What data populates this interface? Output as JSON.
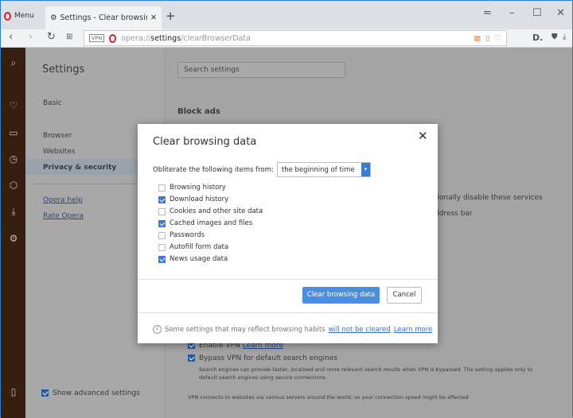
{
  "tabbar": {
    "menu_label": "Menu",
    "tab_title": "Settings - Clear browsing data",
    "new_tab": "+"
  },
  "toolbar": {
    "url_host": "opera://",
    "url_path": "settings",
    "url_rest": "/clearBrowserData",
    "vpn_badge": "VPN"
  },
  "nav": {
    "title": "Settings",
    "items": [
      "Basic",
      "Browser",
      "Websites",
      "Privacy & security"
    ],
    "links": [
      "Opera help",
      "Rate Opera"
    ],
    "show_advanced": "Show advanced settings",
    "show_advanced_checked": true
  },
  "main": {
    "search_placeholder": "Search settings",
    "block_ads": "Block ads",
    "partial1": "tionally disable these services",
    "partial2": "ddress bar",
    "enable_vpn": "Enable VPN",
    "learn_more": "Learn more",
    "bypass_vpn": "Bypass VPN for default search engines",
    "bypass_desc1": "Search engines can provide faster, localised and more relevant search results when VPN is bypassed. The setting applies only to",
    "bypass_desc2": "default search engines using secure connections.",
    "vpn_note": "VPN connects to websites via various servers around the world, so your connection speed might be affected"
  },
  "dialog": {
    "title": "Clear browsing data",
    "obliterate_label": "Obliterate the following items from:",
    "range": "the beginning of time",
    "items": [
      {
        "label": "Browsing history",
        "checked": false
      },
      {
        "label": "Download history",
        "checked": true
      },
      {
        "label": "Cookies and other site data",
        "checked": false
      },
      {
        "label": "Cached images and files",
        "checked": true
      },
      {
        "label": "Passwords",
        "checked": false
      },
      {
        "label": "Autofill form data",
        "checked": false
      },
      {
        "label": "News usage data",
        "checked": true
      }
    ],
    "clear_button": "Clear browsing data",
    "cancel_button": "Cancel",
    "footer_text": "Some settings that may reflect browsing habits",
    "footer_link": "will not be cleared",
    "footer_learn": "Learn more"
  },
  "colors": {
    "accent": "#3a7bd5",
    "opera_red": "#e0202a",
    "sidebar": "#351f0e"
  }
}
